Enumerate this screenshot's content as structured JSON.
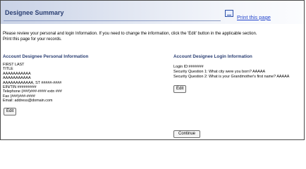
{
  "header": {
    "title": "Designee Summary",
    "print_label": "Print this page"
  },
  "intro": {
    "line1": "Please review your personal and login Information. If you need to change the information, click the 'Edit' button in the applicable section.",
    "line2": "Print this page for your records."
  },
  "personal": {
    "heading": "Account Designee Personal Information",
    "lines": [
      "FIRST LAST",
      "TITLE",
      "AAAAAAAAAAA",
      "AAAAAAAAAAA",
      "AAAAAAAAAAAA, ST  #####-####",
      "EIN/TIN #########",
      "Telephone (###)###-#### extn ###",
      "Fax (###)###-####",
      "Email: address@domain.com"
    ],
    "edit_label": "Edit"
  },
  "login": {
    "heading": "Account Designee Login Information",
    "lines": [
      "Login ID:#######",
      "Security Question 1: What city were you born? AAAAA",
      "Security Question 2: What is your Grandmother's first name? AAAAA"
    ],
    "edit_label": "Edit"
  },
  "actions": {
    "continue_label": "Continue"
  }
}
